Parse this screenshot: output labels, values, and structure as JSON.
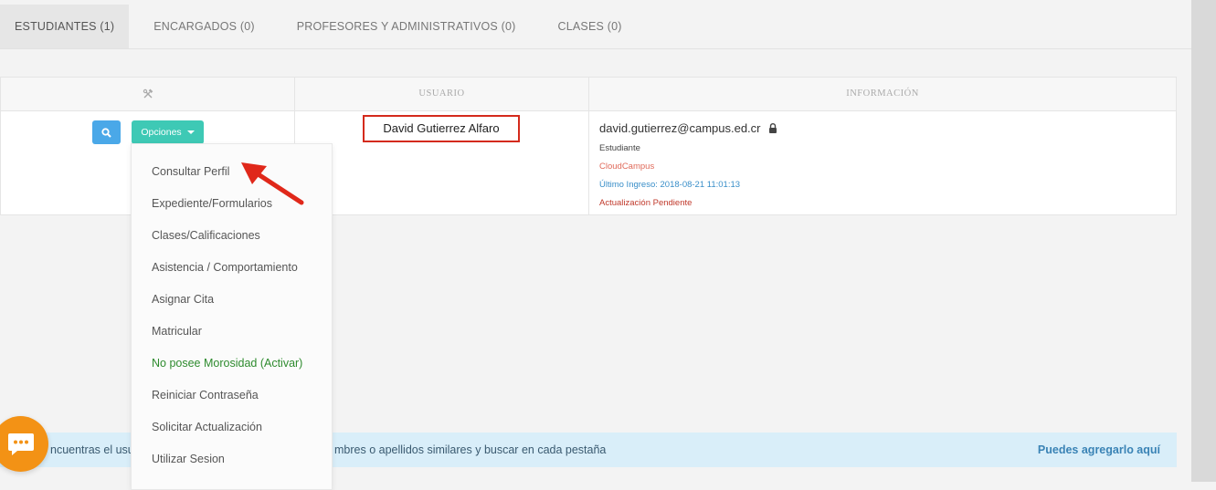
{
  "tabs": [
    {
      "label": "ESTUDIANTES (1)",
      "active": true
    },
    {
      "label": "ENCARGADOS (0)"
    },
    {
      "label": "PROFESORES Y ADMINISTRATIVOS (0)"
    },
    {
      "label": "CLASES (0)"
    }
  ],
  "table": {
    "headers": {
      "tools_icon": "tools-icon",
      "user": "USUARIO",
      "info": "INFORMACIÓN"
    },
    "row": {
      "options_label": "Opciones",
      "name": "David Gutierrez Alfaro",
      "email": "david.gutierrez@campus.ed.cr",
      "role": "Estudiante",
      "org": "CloudCampus",
      "last_login": "Último Ingreso: 2018-08-21 11:01:13",
      "status": "Actualización Pendiente"
    }
  },
  "dropdown": {
    "items": [
      "Consultar Perfil",
      "Expediente/Formularios",
      "Clases/Calificaciones",
      "Asistencia / Comportamiento",
      "Asignar Cita",
      "Matricular",
      "No posee Morosidad (Activar)",
      "Reiniciar Contraseña",
      "Solicitar Actualización",
      "Utilizar Sesion"
    ]
  },
  "alert": {
    "text_left": "ncuentras el usu",
    "text_right": "mbres o apellidos similares y buscar en cada pestaña",
    "link": "Puedes agregarlo aquí"
  },
  "colors": {
    "accent_teal": "#3ec9b5",
    "search_blue": "#4aa8e8",
    "highlight_red": "#d42a1c",
    "green": "#2e8b2e",
    "chat_orange": "#f39215"
  }
}
